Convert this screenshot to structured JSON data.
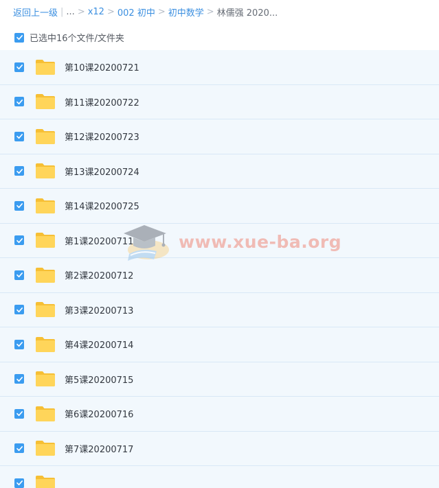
{
  "breadcrumb": {
    "back_label": "返回上一级",
    "pipe": "|",
    "ellipsis": "...",
    "separator": ">",
    "items": [
      "x12",
      "002 初中",
      "初中数学"
    ],
    "current": "林儒强 2020..."
  },
  "selection": {
    "label": "已选中16个文件/文件夹",
    "checked": true
  },
  "files": [
    {
      "name": "第10课20200721",
      "checked": true
    },
    {
      "name": "第11课20200722",
      "checked": true
    },
    {
      "name": "第12课20200723",
      "checked": true
    },
    {
      "name": "第13课20200724",
      "checked": true
    },
    {
      "name": "第14课20200725",
      "checked": true
    },
    {
      "name": "第1课20200711",
      "checked": true
    },
    {
      "name": "第2课20200712",
      "checked": true
    },
    {
      "name": "第3课20200713",
      "checked": true
    },
    {
      "name": "第4课20200714",
      "checked": true
    },
    {
      "name": "第5课20200715",
      "checked": true
    },
    {
      "name": "第6课20200716",
      "checked": true
    },
    {
      "name": "第7课20200717",
      "checked": true
    },
    {
      "name": "",
      "checked": true
    }
  ],
  "icons": {
    "checkbox": "check-icon",
    "folder": "folder-icon",
    "watermark_logo": "graduation-cap-book-icon"
  },
  "watermark": {
    "text": "www.xue-ba.org"
  },
  "colors": {
    "accent": "#3b9cf0",
    "link": "#3b8fe0",
    "row_bg": "#f2f8fd",
    "row_border": "#d8e8f6",
    "folder": "#ffcf4d",
    "watermark_text": "#f08a7c"
  }
}
